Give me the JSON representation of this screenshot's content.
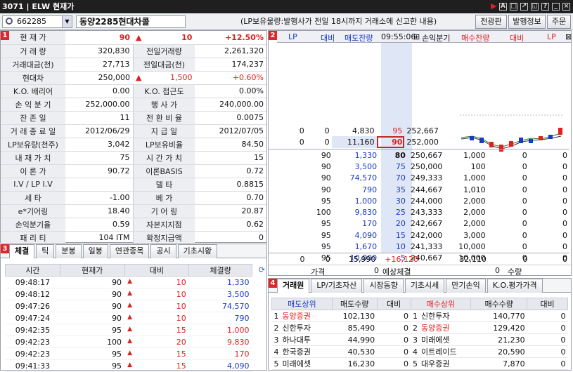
{
  "window": {
    "code": "3071",
    "title": "ELW 현재가"
  },
  "toolbar": {
    "stock_code": "662285",
    "stock_name": "동양2285현대차콜",
    "notice": "(LP보유물량:발행사가 전일 18시까지 거래소에 신고한 내용)",
    "buttons": [
      "전광판",
      "발행정보",
      "주문"
    ]
  },
  "panel1": {
    "number": "1",
    "rows": [
      {
        "l1": "현 재 가",
        "v1": "90",
        "arrow": "▲",
        "v2": "10",
        "v3": "+12.50%"
      },
      {
        "l1": "거 래 량",
        "v1": "320,830",
        "l2": "전일거래량",
        "v2": "2,261,320"
      },
      {
        "l1": "거래대금(천)",
        "v1": "27,713",
        "l2": "전일대금(천)",
        "v2": "174,237"
      },
      {
        "l1": "현대차",
        "v1": "250,000",
        "arrow": "▲",
        "v2": "1,500",
        "v3": "+0.60%"
      },
      {
        "l1": "K.O. 배리어",
        "v1": "0.00",
        "l2": "K.O. 접근도",
        "v2": "0.00%"
      },
      {
        "l1": "손 익 분 기",
        "v1": "252,000.00",
        "l2": "행 사 가",
        "v2": "240,000.00"
      },
      {
        "l1": "잔 존 일",
        "v1": "11",
        "l2": "전 환 비 율",
        "v2": "0.0075"
      },
      {
        "l1": "거 래 종 료 일",
        "v1": "2012/06/29",
        "l2": "지 급 일",
        "v2": "2012/07/05"
      },
      {
        "l1": "LP보유량(천주)",
        "v1": "3,042",
        "l2": "LP보유비율",
        "v2": "84.50"
      },
      {
        "l1": "내 재 가 치",
        "v1": "75",
        "l2": "시 간 가 치",
        "v2": "15"
      },
      {
        "l1": "이 론 가",
        "v1": "90.72",
        "l2": "이론BASIS",
        "v2": "0.72"
      },
      {
        "l1": "I.V / LP I.V",
        "v1": "",
        "l2": "델 타",
        "v2": "0.8815"
      },
      {
        "l1": "세 타",
        "v1": "-1.00",
        "l2": "베 가",
        "v2": "0.70"
      },
      {
        "l1": "e*기어링",
        "v1": "18.40",
        "l2": "기 어 링",
        "v2": "20.87"
      },
      {
        "l1": "손익분기율",
        "v1": "0.59",
        "l2": "자본지지점",
        "v2": "0.62"
      },
      {
        "l1": "패 리 티",
        "v1": "104",
        "v1b": "ITM",
        "l2": "확정지급액",
        "v2": "0"
      }
    ]
  },
  "panel2": {
    "number": "2",
    "headers": [
      "LP",
      "대비",
      "매도잔량",
      "09:55:06",
      "손익분기",
      "매수잔량",
      "대비",
      "LP"
    ],
    "asks": [
      {
        "lp": "0",
        "diff": "0",
        "qty": "4,830",
        "price": "95",
        "bep": "252,667"
      },
      {
        "lp": "0",
        "diff": "0",
        "qty": "11,160",
        "price": "90",
        "bep": "252,000"
      }
    ],
    "bids": [
      {
        "diff": "90",
        "qty": "1,330",
        "price": "80",
        "bep": "250,667",
        "bqty": "1,000",
        "bdiff": "0",
        "blp": "0"
      },
      {
        "diff": "90",
        "qty": "3,500",
        "price": "75",
        "bep": "250,000",
        "bqty": "100",
        "bdiff": "0",
        "blp": "0"
      },
      {
        "diff": "90",
        "qty": "74,570",
        "price": "70",
        "bep": "249,333",
        "bqty": "1,000",
        "bdiff": "0",
        "blp": "0"
      },
      {
        "diff": "90",
        "qty": "790",
        "price": "35",
        "bep": "244,667",
        "bqty": "1,010",
        "bdiff": "0",
        "blp": "0"
      },
      {
        "diff": "95",
        "qty": "1,000",
        "price": "30",
        "bep": "244,000",
        "bqty": "2,000",
        "bdiff": "0",
        "blp": "0"
      },
      {
        "diff": "100",
        "qty": "9,830",
        "price": "25",
        "bep": "243,333",
        "bqty": "2,000",
        "bdiff": "0",
        "blp": "0"
      },
      {
        "diff": "95",
        "qty": "170",
        "price": "20",
        "bep": "242,667",
        "bqty": "2,000",
        "bdiff": "0",
        "blp": "0"
      },
      {
        "diff": "95",
        "qty": "4,090",
        "price": "15",
        "bep": "242,000",
        "bqty": "3,000",
        "bdiff": "0",
        "blp": "0"
      },
      {
        "diff": "95",
        "qty": "1,670",
        "price": "10",
        "bep": "241,333",
        "bqty": "10,000",
        "bdiff": "0",
        "blp": "0"
      },
      {
        "diff": "95",
        "qty": "10,000",
        "price": "5",
        "bep": "240,667",
        "bqty": "10,000",
        "bdiff": "0",
        "blp": "0"
      }
    ],
    "totals": {
      "lp": "0",
      "diff": "0",
      "ask_total": "15,990",
      "delta": "+16,120",
      "bid_total": "32,110",
      "bdiff": "0",
      "blp": "0"
    },
    "footer": {
      "price_label": "가격",
      "price": "0",
      "expected_label": "예상체결",
      "expected": "0",
      "qty_label": "수량"
    }
  },
  "panel3": {
    "number": "3",
    "tabs": [
      "체결",
      "틱",
      "분봉",
      "일봉",
      "연관종목",
      "공시",
      "기초시황"
    ],
    "headers": [
      "시간",
      "현재가",
      "대비",
      "체결량"
    ],
    "rows": [
      {
        "t": "09:48:17",
        "p": "90",
        "d": "10",
        "v": "1,330"
      },
      {
        "t": "09:48:12",
        "p": "90",
        "d": "10",
        "v": "3,500"
      },
      {
        "t": "09:47:26",
        "p": "90",
        "d": "10",
        "v": "74,570"
      },
      {
        "t": "09:47:24",
        "p": "90",
        "d": "10",
        "v": "790"
      },
      {
        "t": "09:42:35",
        "p": "95",
        "d": "15",
        "v": "1,000"
      },
      {
        "t": "09:42:23",
        "p": "100",
        "d": "20",
        "v": "9,830"
      },
      {
        "t": "09:42:23",
        "p": "95",
        "d": "15",
        "v": "170"
      },
      {
        "t": "09:41:33",
        "p": "95",
        "d": "15",
        "v": "4,090"
      }
    ]
  },
  "panel4": {
    "number": "4",
    "tabs": [
      "거래원",
      "LP/기초자산",
      "시장동향",
      "기초시세",
      "만기손익",
      "K.O.평가가격"
    ],
    "headers": [
      "매도상위",
      "매도수량",
      "대비",
      "매수상위",
      "매수수량",
      "대비"
    ],
    "rows": [
      {
        "n": "1",
        "s": "동양증권",
        "sq": "102,130",
        "sd": "0",
        "n2": "1",
        "b": "신한투자",
        "bq": "140,770",
        "bd": "0"
      },
      {
        "n": "2",
        "s": "신한투자",
        "sq": "85,490",
        "sd": "0",
        "n2": "2",
        "b": "동양증권",
        "bq": "129,420",
        "bd": "0"
      },
      {
        "n": "3",
        "s": "하나대투",
        "sq": "44,990",
        "sd": "0",
        "n2": "3",
        "b": "미래에셋",
        "bq": "21,230",
        "bd": "0"
      },
      {
        "n": "4",
        "s": "한국증권",
        "sq": "40,530",
        "sd": "0",
        "n2": "4",
        "b": "이트레이드",
        "bq": "20,590",
        "bd": "0"
      },
      {
        "n": "5",
        "s": "미래에셋",
        "sq": "16,230",
        "sd": "0",
        "n2": "5",
        "b": "대우증권",
        "bq": "7,870",
        "bd": "0"
      }
    ]
  },
  "colors": {
    "up": "#e0201f",
    "down": "#1738c8",
    "badge": "#e0262a"
  }
}
